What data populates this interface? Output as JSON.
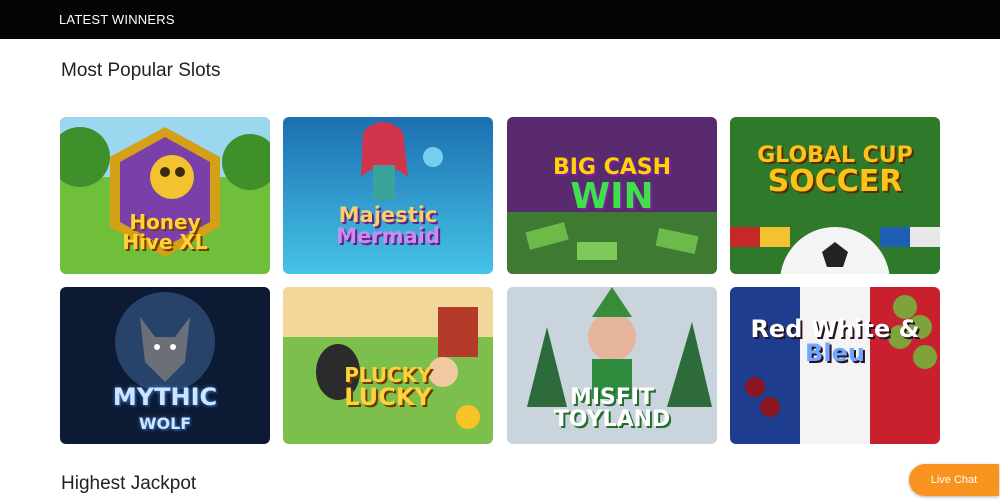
{
  "header": {
    "title": "LATEST WINNERS"
  },
  "sections": {
    "popular": {
      "title": "Most Popular Slots"
    },
    "jackpot": {
      "title": "Highest Jackpot"
    }
  },
  "games": [
    {
      "name": "Honey Hive XL",
      "line1": "Honey",
      "line2": "Hive XL"
    },
    {
      "name": "Majestic Mermaid",
      "line1": "Majestic",
      "line2": "Mermaid"
    },
    {
      "name": "Big Cash Win",
      "line1": "BIG CASH",
      "line2": "WIN"
    },
    {
      "name": "Global Cup Soccer",
      "line1": "GLOBAL CUP",
      "line2": "SOCCER"
    },
    {
      "name": "Mythic Wolf",
      "line1": "MYTHIC",
      "line2": "WOLF"
    },
    {
      "name": "Plucky Lucky",
      "line1": "PLUCKY",
      "line2": "LUCKY"
    },
    {
      "name": "Misfit Toyland",
      "line1": "MISFIT",
      "line2": "TOYLAND"
    },
    {
      "name": "Red White & Bleu",
      "line1": "Red White &",
      "line2": "Bleu"
    }
  ],
  "live_chat": {
    "label": "Live Chat"
  },
  "colors": {
    "accent": "#f7931e",
    "header_bg": "#050505"
  }
}
